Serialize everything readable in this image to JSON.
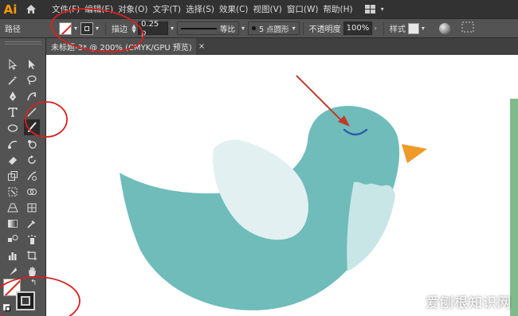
{
  "app": {
    "logo": "Ai"
  },
  "menu": [
    "文件(F)",
    "编辑(E)",
    "对象(O)",
    "文字(T)",
    "选择(S)",
    "效果(C)",
    "视图(V)",
    "窗口(W)",
    "帮助(H)"
  ],
  "control": {
    "selection_label": "路径",
    "stroke_label": "描边",
    "stroke_weight": "0.25 p",
    "profile_label": "等比",
    "brush_label": "5 点圆形",
    "opacity_label": "不透明度",
    "opacity_value": "100%",
    "style_label": "样式"
  },
  "document": {
    "tab_title": "未标题-3* @ 200% (CMYK/GPU 预览)",
    "close": "×"
  },
  "colors": {
    "bird_body": "#6fbcba",
    "wing": "#e2f0f1",
    "beak": "#ee9a28",
    "eye": "#2b5aa8",
    "arrow": "#c0392b",
    "annotation_circle": "#d82020",
    "side_strip": "#7fbb8a"
  },
  "icons": [
    "home-icon",
    "workspace-icon",
    "brush-library-icon",
    "align-icon"
  ],
  "watermark": "爱刨根知识网"
}
